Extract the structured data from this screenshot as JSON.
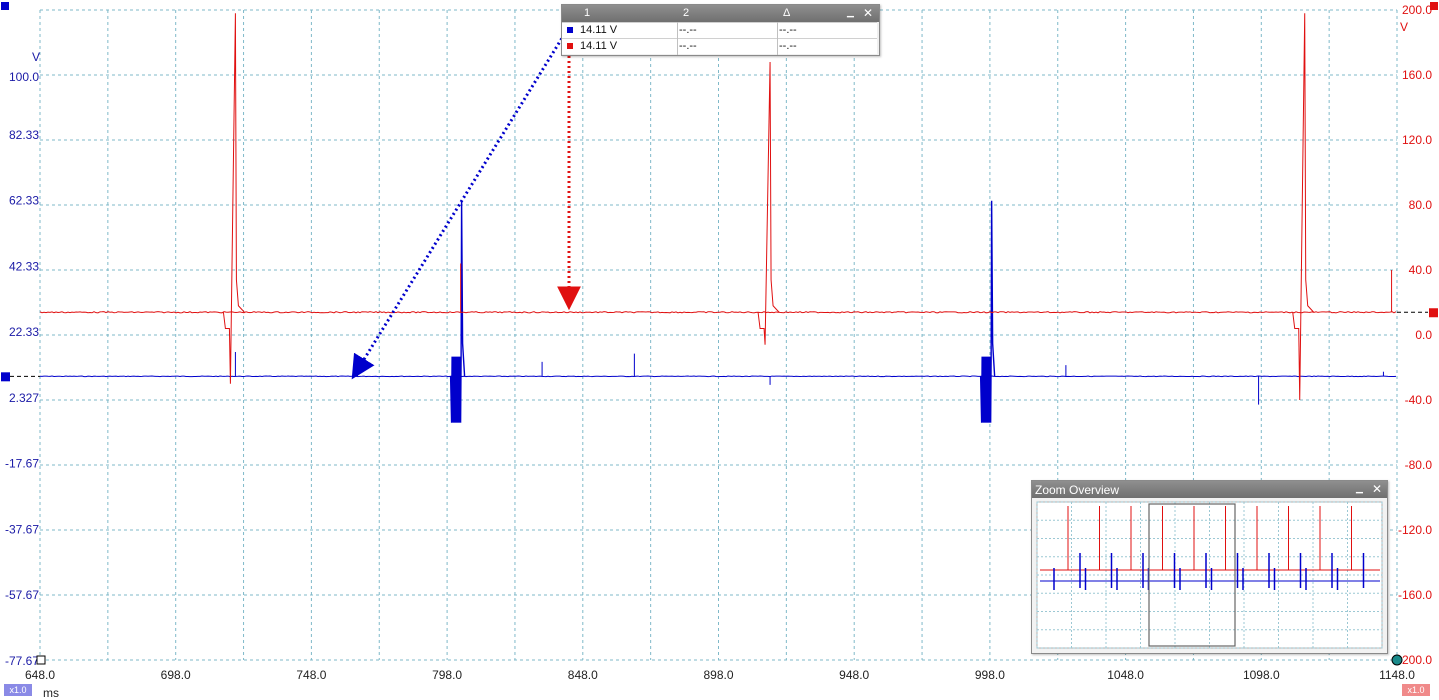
{
  "chart_data": {
    "type": "line",
    "x_unit": "ms",
    "xlim": [
      648.0,
      1148.0
    ],
    "x_ticks": [
      "648.0",
      "698.0",
      "748.0",
      "798.0",
      "848.0",
      "898.0",
      "948.0",
      "998.0",
      "1048.0",
      "1098.0",
      "1148.0"
    ],
    "y_left": {
      "unit": "V",
      "range": [
        -77.67,
        120.0
      ],
      "ticks": [
        "100.0",
        "82.33",
        "62.33",
        "42.33",
        "22.33",
        "2.327",
        "-17.67",
        "-37.67",
        "-57.67",
        "-77.67"
      ],
      "tick_values": [
        100.0,
        82.33,
        62.33,
        42.33,
        22.33,
        2.327,
        -17.67,
        -37.67,
        -57.67,
        -77.67
      ]
    },
    "y_right": {
      "unit": "V",
      "range": [
        -200.0,
        200.0
      ],
      "ticks": [
        "200.0",
        "160.0",
        "120.0",
        "80.0",
        "40.0",
        "0.0",
        "-40.0",
        "-80.0",
        "-120.0",
        "-160.0",
        "-200.0"
      ],
      "tick_values": [
        200.0,
        160.0,
        120.0,
        80.0,
        40.0,
        0.0,
        -40.0,
        -80.0,
        -120.0,
        -160.0,
        -200.0
      ]
    },
    "series": [
      {
        "color": "#0000cc",
        "axis": "left",
        "baseline": 8.6,
        "bursts": [
          {
            "x": 801.5,
            "low": -5.5,
            "high": 62.0
          },
          {
            "x": 996.8,
            "low": -5.5,
            "high": 62.0
          }
        ],
        "spikes": [
          {
            "x": 720.0,
            "value": 16.0
          },
          {
            "x": 765.0,
            "value": 14.5
          },
          {
            "x": 833.0,
            "value": 13.0
          },
          {
            "x": 867.0,
            "value": 15.5
          },
          {
            "x": 917.0,
            "value": 6.0
          },
          {
            "x": 1026.0,
            "value": 12.0
          },
          {
            "x": 1097.0,
            "value": 0.0
          },
          {
            "x": 1143.0,
            "value": 10.0
          }
        ]
      },
      {
        "color": "#e01010",
        "axis": "right",
        "baseline": 14.0,
        "ringing": [
          {
            "x": 720.0,
            "high": 198.0,
            "low": -30.0
          },
          {
            "x": 917.0,
            "high": 168.0,
            "low": -6.0
          },
          {
            "x": 1114.0,
            "high": 198.0,
            "low": -40.0
          }
        ],
        "spikes": [
          {
            "x": 803.0,
            "value": 44.0
          },
          {
            "x": 1146.0,
            "value": 40.0
          }
        ]
      }
    ],
    "grid": true
  },
  "cursor_readout": {
    "headers": [
      "1",
      "2",
      "Δ"
    ],
    "rows": [
      {
        "swatch": "#0000cc",
        "values": [
          "14.11 V",
          "--.--",
          "--.--"
        ]
      },
      {
        "swatch": "#e01010",
        "values": [
          "14.11 V",
          "--.--",
          "--.--"
        ]
      }
    ],
    "minimize_glyph": "▁",
    "close_glyph": "✕"
  },
  "zoom_overview": {
    "title": "Zoom Overview",
    "minimize_glyph": "▁",
    "close_glyph": "✕"
  },
  "scale_badges": {
    "left": "x1.0",
    "right": "x1.0"
  },
  "colors": {
    "ch1": "#0000cc",
    "ch2": "#e01010",
    "grid": "#7fb9c9"
  },
  "icons": {
    "ch1_marker": "blue-square-marker",
    "ch2_marker": "red-square-marker",
    "x_origin": "hollow-square-marker",
    "x_end": "teal-circle-marker"
  }
}
